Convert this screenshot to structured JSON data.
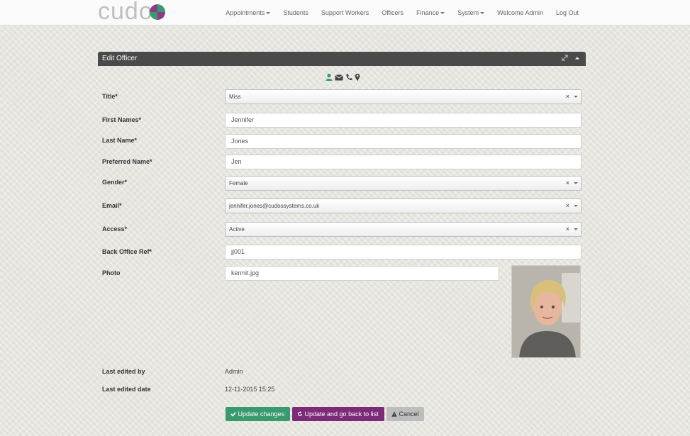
{
  "nav": {
    "logo_text": "cudos",
    "items": [
      {
        "label": "Appointments",
        "dropdown": true
      },
      {
        "label": "Students",
        "dropdown": false
      },
      {
        "label": "Support Workers",
        "dropdown": false
      },
      {
        "label": "Officers",
        "dropdown": false
      },
      {
        "label": "Finance",
        "dropdown": true
      },
      {
        "label": "System",
        "dropdown": true
      },
      {
        "label": "Welcome Admin",
        "dropdown": false
      },
      {
        "label": "Log Out",
        "dropdown": false
      }
    ]
  },
  "panel": {
    "title": "Edit Officer",
    "tools": [
      "expand-icon",
      "collapse-icon"
    ],
    "tab_icons": [
      "user-icon",
      "envelope-icon",
      "phone-icon",
      "map-marker-icon"
    ]
  },
  "form": {
    "title": {
      "label": "Title*",
      "value": "Miss"
    },
    "first_names": {
      "label": "First Names*",
      "value": "Jennifer"
    },
    "last_name": {
      "label": "Last Name*",
      "value": "Jones"
    },
    "preferred_name": {
      "label": "Preferred Name*",
      "value": "Jen"
    },
    "gender": {
      "label": "Gender*",
      "value": "Female"
    },
    "email": {
      "label": "Email*",
      "value": "jennifer.jones@cudossystems.co.uk"
    },
    "access": {
      "label": "Access*",
      "value": "Active"
    },
    "back_office_ref": {
      "label": "Back Office Ref*",
      "value": "jj001"
    },
    "photo": {
      "label": "Photo",
      "value": "kermit.jpg"
    },
    "last_edited_by": {
      "label": "Last edited by",
      "value": "Admin"
    },
    "last_edited_date": {
      "label": "Last edited date",
      "value": "12-11-2015 15:25"
    },
    "clear_symbol": "×"
  },
  "buttons": {
    "update": "Update changes",
    "update_back": "Update and go back to list",
    "cancel": "Cancel"
  },
  "colors": {
    "header_bg": "#4a4a4a",
    "accent_green": "#3a9a6f",
    "accent_purple": "#7d2b79",
    "cancel_bg": "#bdbdbd"
  }
}
